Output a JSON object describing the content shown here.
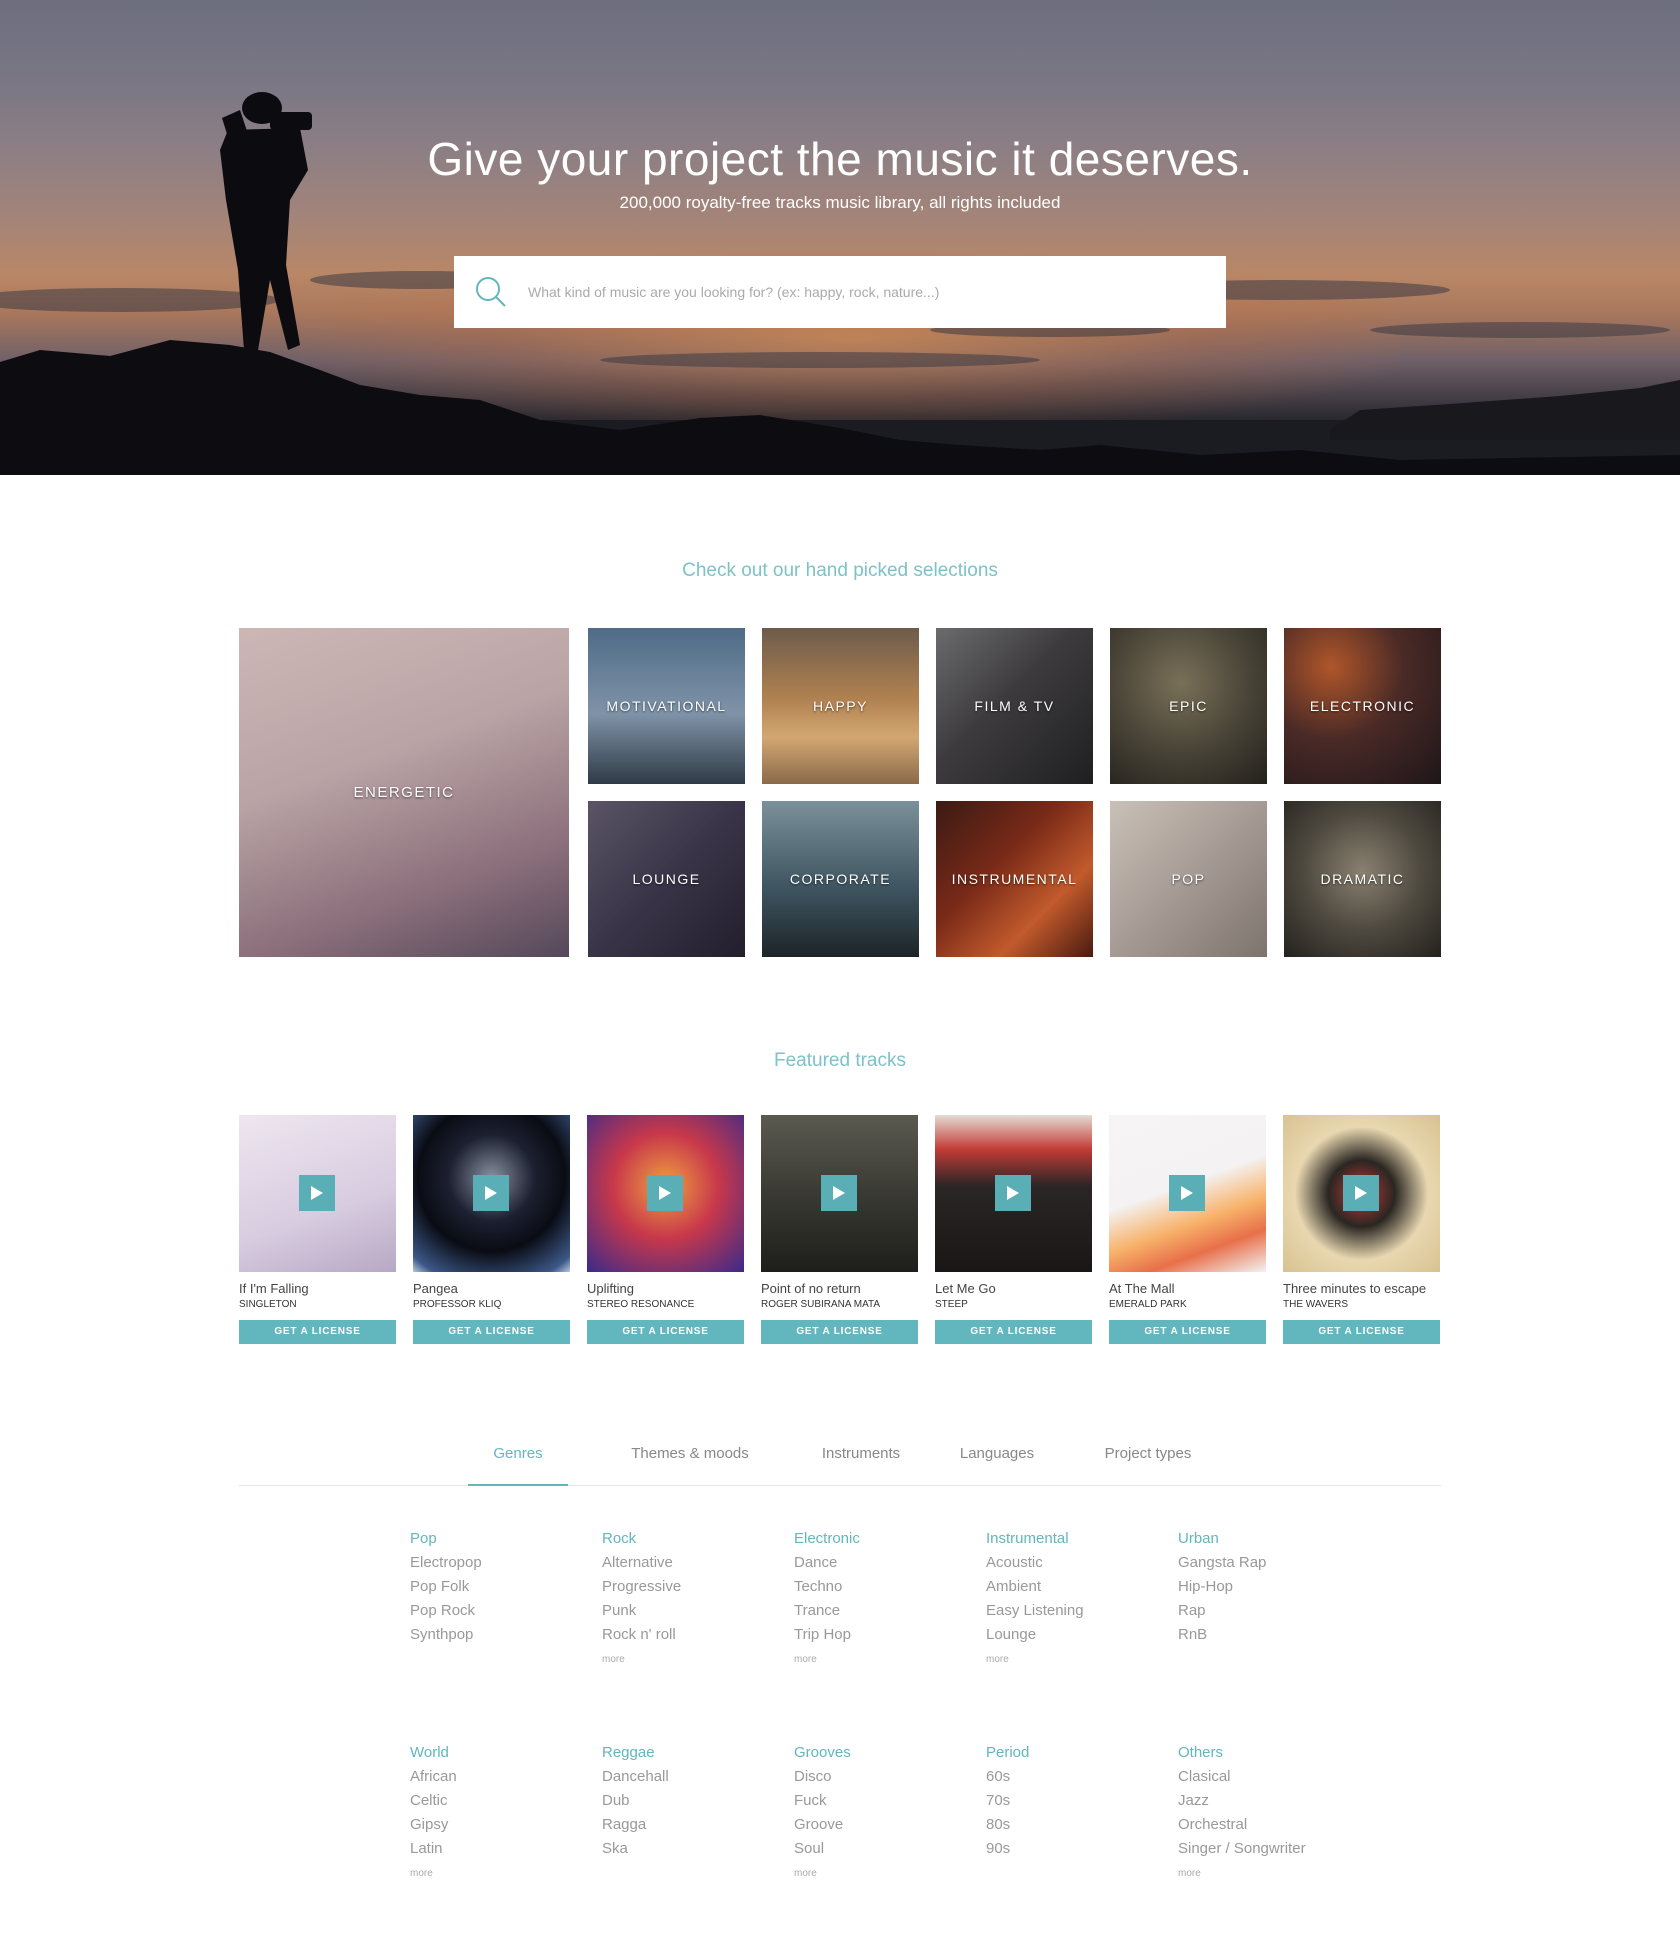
{
  "hero": {
    "title": "Give your project the music it deserves.",
    "subtitle": "200,000 royalty-free tracks music library, all rights included",
    "search_placeholder": "What kind of music are you looking for? (ex: happy, rock, nature...)"
  },
  "selections": {
    "heading": "Check out our hand picked selections",
    "tiles": [
      {
        "label": "Energetic",
        "color": "#b9a3a5"
      },
      {
        "label": "Motivational",
        "color": "#4f6b86"
      },
      {
        "label": "Happy",
        "color": "#b08150"
      },
      {
        "label": "Film & TV",
        "color": "#3c3a3c"
      },
      {
        "label": "Epic",
        "color": "#4a4538"
      },
      {
        "label": "Electronic",
        "color": "#4a2a26"
      },
      {
        "label": "Lounge",
        "color": "#3a3448"
      },
      {
        "label": "Corporate",
        "color": "#3f5662"
      },
      {
        "label": "Instrumental",
        "color": "#7a2a18"
      },
      {
        "label": "Pop",
        "color": "#a59b94"
      },
      {
        "label": "Dramatic",
        "color": "#4f4a40"
      }
    ]
  },
  "featured": {
    "heading": "Featured tracks",
    "license_label": "GET A LICENSE",
    "tracks": [
      {
        "title": "If I'm Falling",
        "artist": "SINGLETON",
        "color": "#d8cce0"
      },
      {
        "title": "Pangea",
        "artist": "PROFESSOR KLIQ",
        "color": "#1c2030"
      },
      {
        "title": "Uplifting",
        "artist": "STEREO RESONANCE",
        "color": "#c8384a"
      },
      {
        "title": "Point of no return",
        "artist": "ROGER SUBIRANA MATA",
        "color": "#3a3a34"
      },
      {
        "title": "Let Me Go",
        "artist": "STEEP",
        "color": "#2b2626"
      },
      {
        "title": "At The Mall",
        "artist": "EMERALD PARK",
        "color": "#f4f2f2"
      },
      {
        "title": "Three minutes to escape",
        "artist": "THE WAVERS",
        "color": "#e8d7b0"
      }
    ]
  },
  "tabs": [
    {
      "label": "Genres",
      "active": true
    },
    {
      "label": "Themes & moods",
      "active": false
    },
    {
      "label": "Instruments",
      "active": false
    },
    {
      "label": "Languages",
      "active": false
    },
    {
      "label": "Project types",
      "active": false
    }
  ],
  "genres": {
    "more_label": "more",
    "row1": [
      {
        "head": "Pop",
        "items": [
          "Electropop",
          "Pop Folk",
          "Pop Rock",
          "Synthpop"
        ],
        "more": false
      },
      {
        "head": "Rock",
        "items": [
          "Alternative",
          "Progressive",
          "Punk",
          "Rock n' roll"
        ],
        "more": true
      },
      {
        "head": "Electronic",
        "items": [
          "Dance",
          "Techno",
          "Trance",
          "Trip Hop"
        ],
        "more": true
      },
      {
        "head": "Instrumental",
        "items": [
          "Acoustic",
          "Ambient",
          "Easy Listening",
          "Lounge"
        ],
        "more": true
      },
      {
        "head": "Urban",
        "items": [
          "Gangsta Rap",
          "Hip-Hop",
          "Rap",
          "RnB"
        ],
        "more": false
      }
    ],
    "row2": [
      {
        "head": "World",
        "items": [
          "African",
          "Celtic",
          "Gipsy",
          "Latin"
        ],
        "more": true
      },
      {
        "head": "Reggae",
        "items": [
          "Dancehall",
          "Dub",
          "Ragga",
          "Ska"
        ],
        "more": false
      },
      {
        "head": "Grooves",
        "items": [
          "Disco",
          "Fuck",
          "Groove",
          "Soul"
        ],
        "more": true
      },
      {
        "head": "Period",
        "items": [
          "60s",
          "70s",
          "80s",
          "90s"
        ],
        "more": false
      },
      {
        "head": "Others",
        "items": [
          "Clasical",
          "Jazz",
          "Orchestral",
          "Singer / Songwriter"
        ],
        "more": true
      }
    ]
  }
}
